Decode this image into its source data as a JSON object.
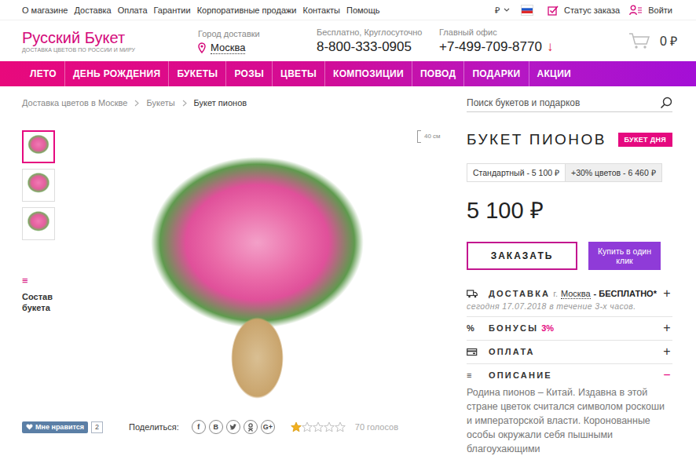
{
  "topbar": {
    "links": [
      "О магазине",
      "Доставка",
      "Оплата",
      "Гарантии",
      "Корпоративные продажи",
      "Контакты",
      "Помощь"
    ],
    "currency": "₽",
    "order_status": "Статус заказа",
    "login": "Войти"
  },
  "header": {
    "logo": "Русский Букет",
    "tagline": "ДОСТАВКА ЦВЕТОВ ПО РОССИИ И МИРУ",
    "city_label": "Город доставки",
    "city": "Москва",
    "free_phone_label": "Бесплатно, Круглосуточно",
    "free_phone": "8-800-333-0905",
    "office_label": "Главный офис",
    "office_phone": "+7-499-709-8770",
    "office_arrow": "↓",
    "cart_total": "0 ₽"
  },
  "nav": [
    "ЛЕТО",
    "ДЕНЬ РОЖДЕНИЯ",
    "БУКЕТЫ",
    "РОЗЫ",
    "ЦВЕТЫ",
    "КОМПОЗИЦИИ",
    "ПОВОД",
    "ПОДАРКИ",
    "АКЦИИ"
  ],
  "breadcrumbs": [
    {
      "label": "Доставка цветов в Москве",
      "current": false
    },
    {
      "label": "Букеты",
      "current": false
    },
    {
      "label": "Букет пионов",
      "current": true
    }
  ],
  "search": {
    "placeholder": "Поиск букетов и подарков"
  },
  "gallery": {
    "thumbnails": [
      {
        "selected": true
      },
      {
        "selected": false
      },
      {
        "selected": false
      }
    ],
    "composition_icon": "≡",
    "composition_label": "Состав букета",
    "size_label": "40 см"
  },
  "product": {
    "title": "БУКЕТ ПИОНОВ",
    "badge": "БУКЕТ ДНЯ",
    "options": [
      {
        "label": "Стандартный - 5 100 ₽",
        "selected": true
      },
      {
        "label": "+30% цветов - 6 460 ₽",
        "selected": false
      }
    ],
    "price": "5 100 ₽",
    "order_button": "ЗАКАЗАТЬ",
    "one_click_button": "Купить в один клик"
  },
  "accordion": [
    {
      "kind": "delivery",
      "title": "ДОСТАВКА",
      "city_prefix": "г.",
      "city": "Москва",
      "price": "- БЕСПЛАТНО*",
      "note": "сегодня 17.07.2018 в течение 3-х часов.",
      "toggle": "+",
      "expanded": false
    },
    {
      "kind": "bonus",
      "icon": "%",
      "title": "БОНУСЫ",
      "value": "3%",
      "toggle": "+",
      "expanded": false
    },
    {
      "kind": "payment",
      "title": "ОПЛАТА",
      "toggle": "+",
      "expanded": false
    },
    {
      "kind": "description",
      "icon": "≡",
      "title": "ОПИСАНИЕ",
      "toggle": "−",
      "expanded": true,
      "text": "Родина пионов – Китай. Издавна в этой стране цветок считался символом роскоши и императорской власти. Коронованные особы окружали себя пышными благоухающими"
    }
  ],
  "social": {
    "like_label": "Мне нравится",
    "like_count": "2",
    "share_label": "Поделиться:",
    "share": [
      {
        "kind": "letter",
        "label": "f"
      },
      {
        "kind": "letter",
        "label": "B"
      },
      {
        "kind": "bird"
      },
      {
        "kind": "ok"
      },
      {
        "kind": "letter",
        "label": "G+"
      }
    ]
  },
  "rating": {
    "stars": 1,
    "max": 5,
    "votes": "70 голосов"
  }
}
